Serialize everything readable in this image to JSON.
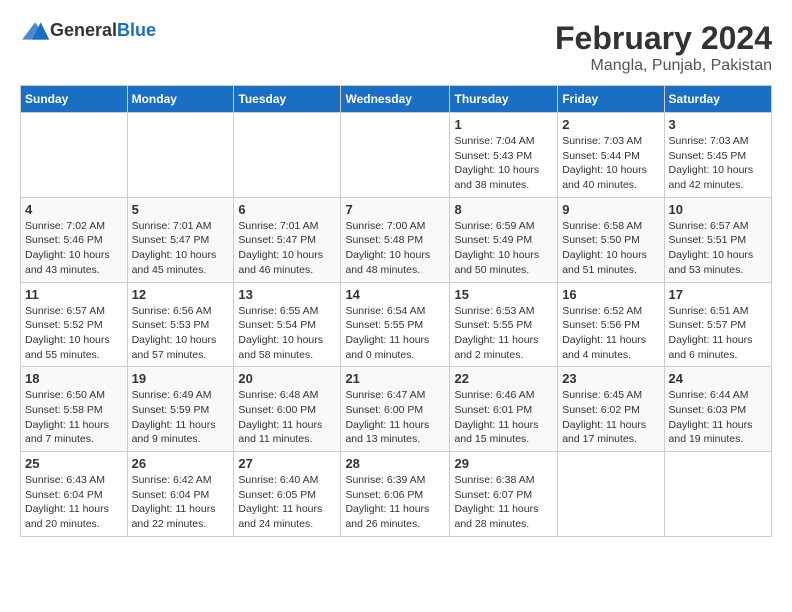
{
  "header": {
    "logo_general": "General",
    "logo_blue": "Blue",
    "title": "February 2024",
    "subtitle": "Mangla, Punjab, Pakistan"
  },
  "calendar": {
    "days_of_week": [
      "Sunday",
      "Monday",
      "Tuesday",
      "Wednesday",
      "Thursday",
      "Friday",
      "Saturday"
    ],
    "weeks": [
      [
        {
          "day": "",
          "sunrise": "",
          "sunset": "",
          "daylight": ""
        },
        {
          "day": "",
          "sunrise": "",
          "sunset": "",
          "daylight": ""
        },
        {
          "day": "",
          "sunrise": "",
          "sunset": "",
          "daylight": ""
        },
        {
          "day": "",
          "sunrise": "",
          "sunset": "",
          "daylight": ""
        },
        {
          "day": "1",
          "sunrise": "Sunrise: 7:04 AM",
          "sunset": "Sunset: 5:43 PM",
          "daylight": "Daylight: 10 hours and 38 minutes."
        },
        {
          "day": "2",
          "sunrise": "Sunrise: 7:03 AM",
          "sunset": "Sunset: 5:44 PM",
          "daylight": "Daylight: 10 hours and 40 minutes."
        },
        {
          "day": "3",
          "sunrise": "Sunrise: 7:03 AM",
          "sunset": "Sunset: 5:45 PM",
          "daylight": "Daylight: 10 hours and 42 minutes."
        }
      ],
      [
        {
          "day": "4",
          "sunrise": "Sunrise: 7:02 AM",
          "sunset": "Sunset: 5:46 PM",
          "daylight": "Daylight: 10 hours and 43 minutes."
        },
        {
          "day": "5",
          "sunrise": "Sunrise: 7:01 AM",
          "sunset": "Sunset: 5:47 PM",
          "daylight": "Daylight: 10 hours and 45 minutes."
        },
        {
          "day": "6",
          "sunrise": "Sunrise: 7:01 AM",
          "sunset": "Sunset: 5:47 PM",
          "daylight": "Daylight: 10 hours and 46 minutes."
        },
        {
          "day": "7",
          "sunrise": "Sunrise: 7:00 AM",
          "sunset": "Sunset: 5:48 PM",
          "daylight": "Daylight: 10 hours and 48 minutes."
        },
        {
          "day": "8",
          "sunrise": "Sunrise: 6:59 AM",
          "sunset": "Sunset: 5:49 PM",
          "daylight": "Daylight: 10 hours and 50 minutes."
        },
        {
          "day": "9",
          "sunrise": "Sunrise: 6:58 AM",
          "sunset": "Sunset: 5:50 PM",
          "daylight": "Daylight: 10 hours and 51 minutes."
        },
        {
          "day": "10",
          "sunrise": "Sunrise: 6:57 AM",
          "sunset": "Sunset: 5:51 PM",
          "daylight": "Daylight: 10 hours and 53 minutes."
        }
      ],
      [
        {
          "day": "11",
          "sunrise": "Sunrise: 6:57 AM",
          "sunset": "Sunset: 5:52 PM",
          "daylight": "Daylight: 10 hours and 55 minutes."
        },
        {
          "day": "12",
          "sunrise": "Sunrise: 6:56 AM",
          "sunset": "Sunset: 5:53 PM",
          "daylight": "Daylight: 10 hours and 57 minutes."
        },
        {
          "day": "13",
          "sunrise": "Sunrise: 6:55 AM",
          "sunset": "Sunset: 5:54 PM",
          "daylight": "Daylight: 10 hours and 58 minutes."
        },
        {
          "day": "14",
          "sunrise": "Sunrise: 6:54 AM",
          "sunset": "Sunset: 5:55 PM",
          "daylight": "Daylight: 11 hours and 0 minutes."
        },
        {
          "day": "15",
          "sunrise": "Sunrise: 6:53 AM",
          "sunset": "Sunset: 5:55 PM",
          "daylight": "Daylight: 11 hours and 2 minutes."
        },
        {
          "day": "16",
          "sunrise": "Sunrise: 6:52 AM",
          "sunset": "Sunset: 5:56 PM",
          "daylight": "Daylight: 11 hours and 4 minutes."
        },
        {
          "day": "17",
          "sunrise": "Sunrise: 6:51 AM",
          "sunset": "Sunset: 5:57 PM",
          "daylight": "Daylight: 11 hours and 6 minutes."
        }
      ],
      [
        {
          "day": "18",
          "sunrise": "Sunrise: 6:50 AM",
          "sunset": "Sunset: 5:58 PM",
          "daylight": "Daylight: 11 hours and 7 minutes."
        },
        {
          "day": "19",
          "sunrise": "Sunrise: 6:49 AM",
          "sunset": "Sunset: 5:59 PM",
          "daylight": "Daylight: 11 hours and 9 minutes."
        },
        {
          "day": "20",
          "sunrise": "Sunrise: 6:48 AM",
          "sunset": "Sunset: 6:00 PM",
          "daylight": "Daylight: 11 hours and 11 minutes."
        },
        {
          "day": "21",
          "sunrise": "Sunrise: 6:47 AM",
          "sunset": "Sunset: 6:00 PM",
          "daylight": "Daylight: 11 hours and 13 minutes."
        },
        {
          "day": "22",
          "sunrise": "Sunrise: 6:46 AM",
          "sunset": "Sunset: 6:01 PM",
          "daylight": "Daylight: 11 hours and 15 minutes."
        },
        {
          "day": "23",
          "sunrise": "Sunrise: 6:45 AM",
          "sunset": "Sunset: 6:02 PM",
          "daylight": "Daylight: 11 hours and 17 minutes."
        },
        {
          "day": "24",
          "sunrise": "Sunrise: 6:44 AM",
          "sunset": "Sunset: 6:03 PM",
          "daylight": "Daylight: 11 hours and 19 minutes."
        }
      ],
      [
        {
          "day": "25",
          "sunrise": "Sunrise: 6:43 AM",
          "sunset": "Sunset: 6:04 PM",
          "daylight": "Daylight: 11 hours and 20 minutes."
        },
        {
          "day": "26",
          "sunrise": "Sunrise: 6:42 AM",
          "sunset": "Sunset: 6:04 PM",
          "daylight": "Daylight: 11 hours and 22 minutes."
        },
        {
          "day": "27",
          "sunrise": "Sunrise: 6:40 AM",
          "sunset": "Sunset: 6:05 PM",
          "daylight": "Daylight: 11 hours and 24 minutes."
        },
        {
          "day": "28",
          "sunrise": "Sunrise: 6:39 AM",
          "sunset": "Sunset: 6:06 PM",
          "daylight": "Daylight: 11 hours and 26 minutes."
        },
        {
          "day": "29",
          "sunrise": "Sunrise: 6:38 AM",
          "sunset": "Sunset: 6:07 PM",
          "daylight": "Daylight: 11 hours and 28 minutes."
        },
        {
          "day": "",
          "sunrise": "",
          "sunset": "",
          "daylight": ""
        },
        {
          "day": "",
          "sunrise": "",
          "sunset": "",
          "daylight": ""
        }
      ]
    ]
  }
}
